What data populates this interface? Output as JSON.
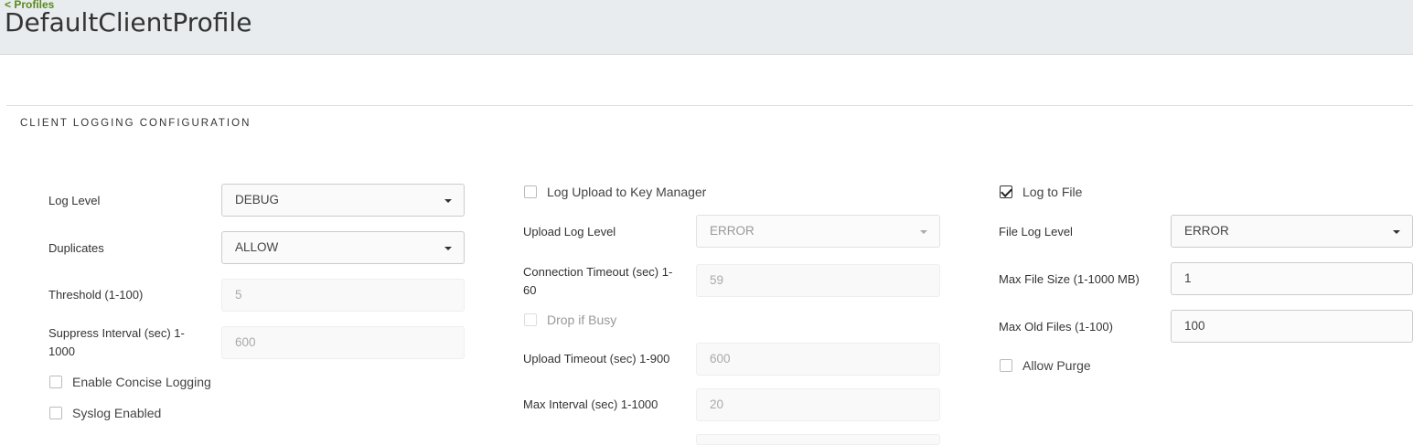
{
  "header": {
    "breadcrumb": "< Profiles",
    "title": "DefaultClientProfile"
  },
  "section": {
    "title": "CLIENT LOGGING CONFIGURATION"
  },
  "col1": {
    "log_level": {
      "label": "Log Level",
      "value": "DEBUG"
    },
    "duplicates": {
      "label": "Duplicates",
      "value": "ALLOW"
    },
    "threshold": {
      "label": "Threshold (1-100)",
      "value": "5"
    },
    "suppress_interval": {
      "label_line1": "Suppress Interval (sec) 1-",
      "label_line2": "1000",
      "value": "600"
    },
    "enable_concise_logging": {
      "label": "Enable Concise Logging",
      "checked": false
    },
    "syslog_enabled": {
      "label": "Syslog Enabled",
      "checked": false
    }
  },
  "col2": {
    "log_upload": {
      "label": "Log Upload to Key Manager",
      "checked": false
    },
    "upload_log_level": {
      "label": "Upload Log Level",
      "value": "ERROR"
    },
    "connection_timeout": {
      "label_line1": "Connection Timeout (sec) 1-",
      "label_line2": "60",
      "value": "59"
    },
    "drop_if_busy": {
      "label": "Drop if Busy",
      "checked": false
    },
    "upload_timeout": {
      "label": "Upload Timeout (sec) 1-900",
      "value": "600"
    },
    "max_interval": {
      "label": "Max Interval (sec) 1-1000",
      "value": "20"
    }
  },
  "col3": {
    "log_to_file": {
      "label": "Log to File",
      "checked": true
    },
    "file_log_level": {
      "label": "File Log Level",
      "value": "ERROR"
    },
    "max_file_size": {
      "label": "Max File Size (1-1000 MB)",
      "value": "1"
    },
    "max_old_files": {
      "label": "Max Old Files (1-100)",
      "value": "100"
    },
    "allow_purge": {
      "label": "Allow Purge",
      "checked": false
    }
  }
}
